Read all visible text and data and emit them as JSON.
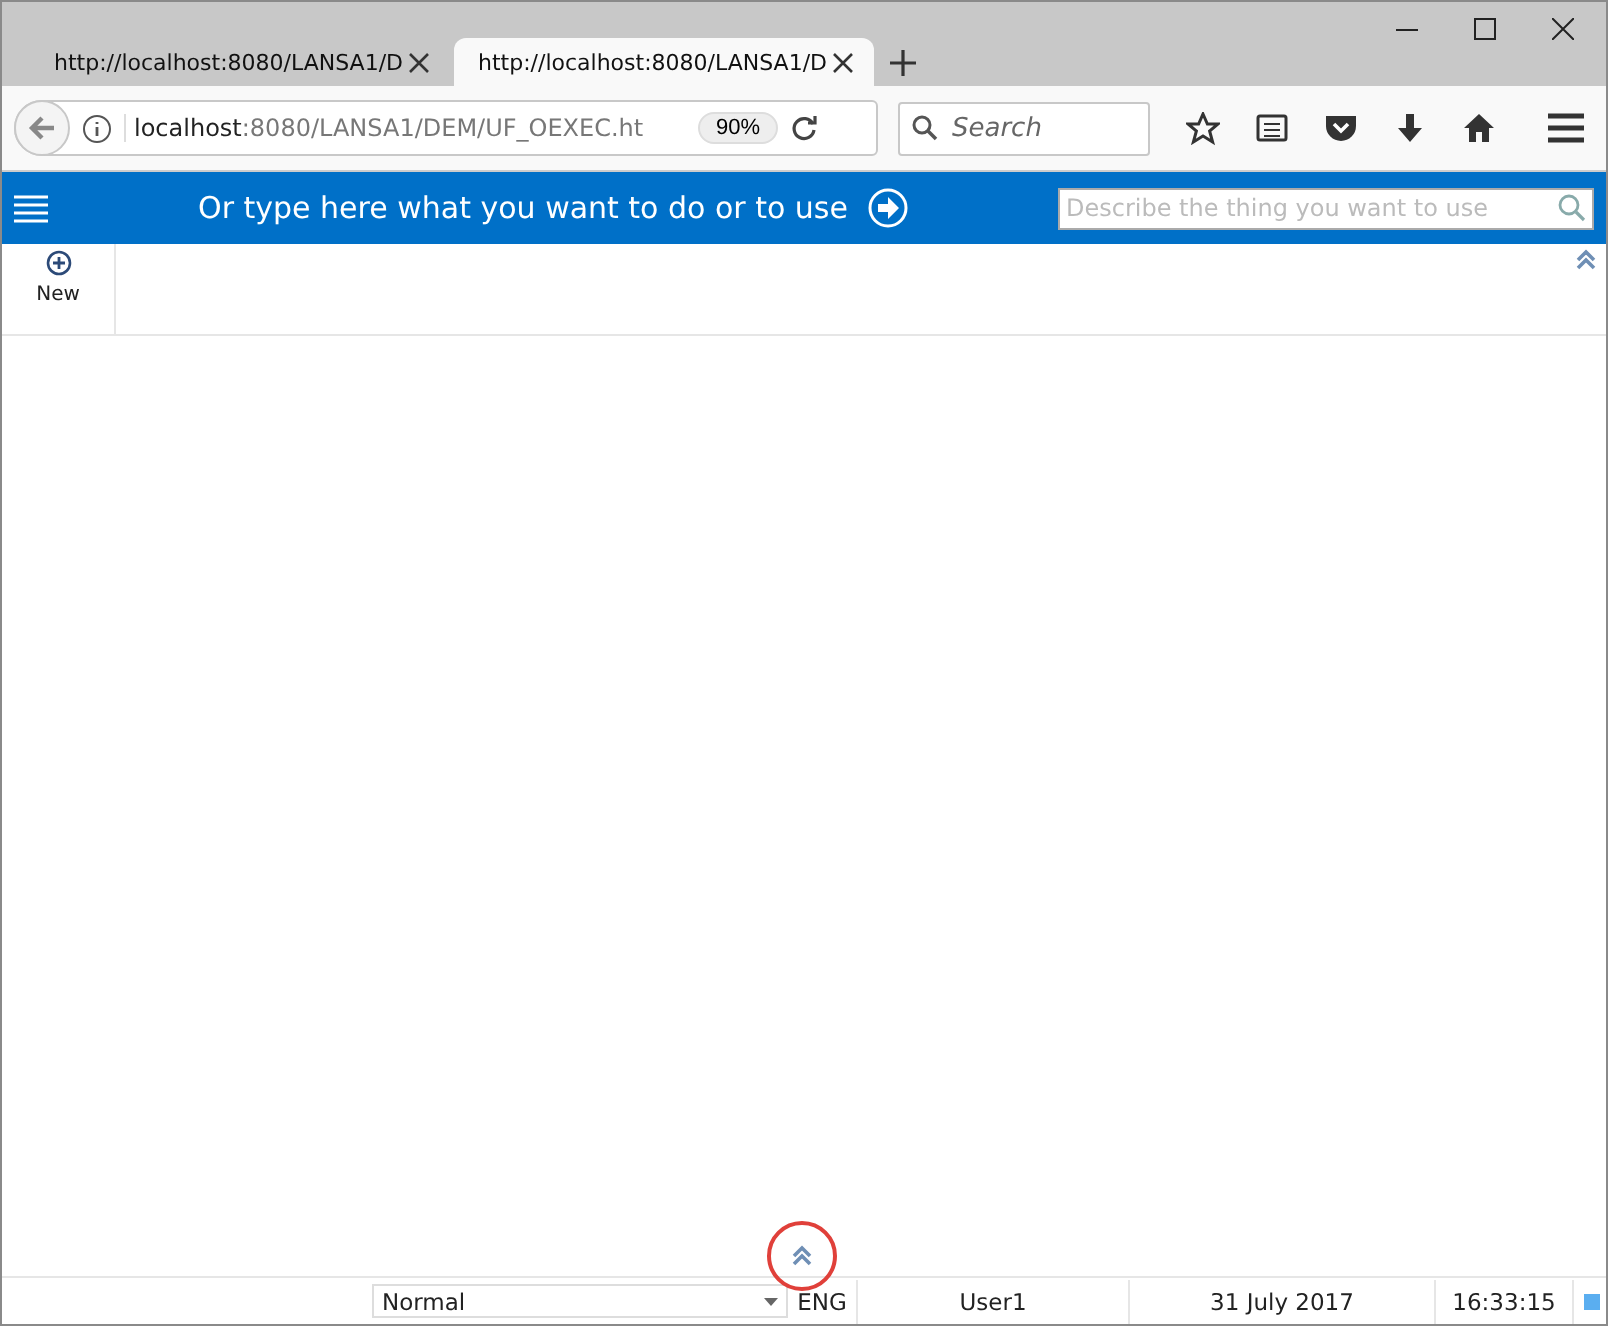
{
  "browser": {
    "tabs": [
      {
        "title": "http://localhost:8080/LANSA1/D",
        "selected": false
      },
      {
        "title": "http://localhost:8080/LANSA1/D",
        "selected": true
      }
    ],
    "address": {
      "host": "localhost",
      "rest": ":8080/LANSA1/DEM/UF_OEXEC.ht"
    },
    "zoom": "90%",
    "search": {
      "placeholder": "Search"
    }
  },
  "app": {
    "prompt": "Or type here what you want to do or to use",
    "search": {
      "placeholder": "Describe the thing you want to use"
    },
    "toolbar": [
      {
        "label": "New"
      }
    ]
  },
  "status_bar": {
    "mode": "Normal",
    "language": "ENG",
    "user": "User1",
    "date": "31 July 2017",
    "time": "16:33:15"
  }
}
